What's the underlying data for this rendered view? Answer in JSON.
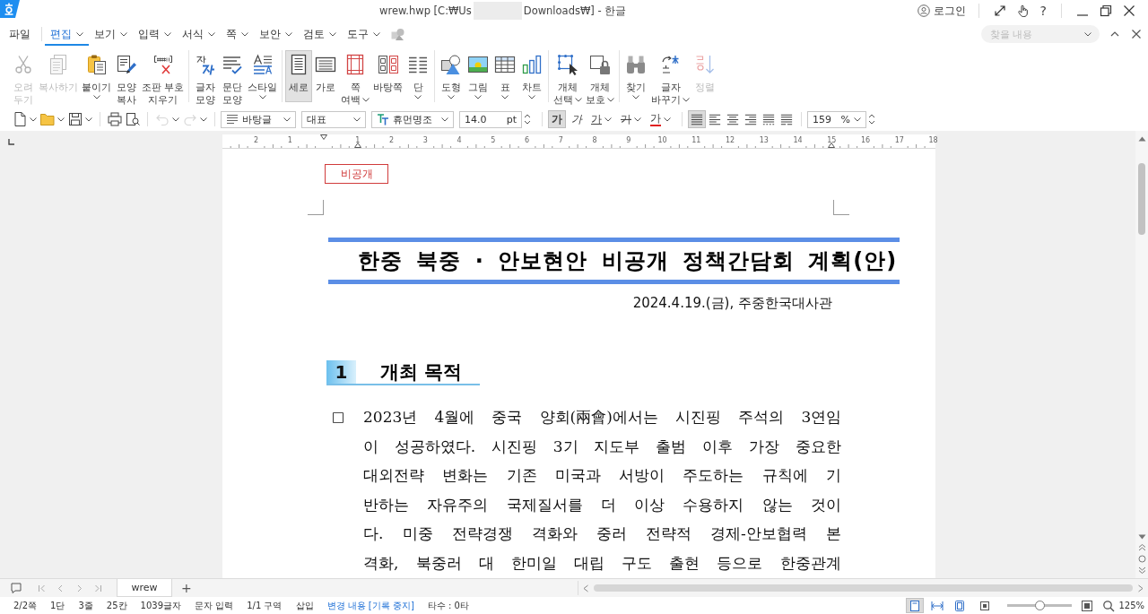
{
  "title_bar": {
    "title_parts": [
      "wrew.hwp [C:₩Us",
      "Downloads₩] - 한글"
    ],
    "login": "로그인",
    "help": "?"
  },
  "menu": {
    "items": [
      {
        "label": "파일",
        "kind": "plain",
        "selected": false
      },
      {
        "label": "편집",
        "kind": "dropdown",
        "selected": true
      },
      {
        "label": "보기",
        "kind": "dropdown",
        "selected": false
      },
      {
        "label": "입력",
        "kind": "dropdown",
        "selected": false
      },
      {
        "label": "서식",
        "kind": "dropdown",
        "selected": false
      },
      {
        "label": "쪽",
        "kind": "dropdown",
        "selected": false
      },
      {
        "label": "보안",
        "kind": "dropdown",
        "selected": false
      },
      {
        "label": "검토",
        "kind": "dropdown",
        "selected": false
      },
      {
        "label": "도구",
        "kind": "dropdown",
        "selected": false
      }
    ],
    "find": {
      "placeholder": "찾을 내용"
    }
  },
  "ribbon": {
    "groups": [
      {
        "items": [
          {
            "lines": [
              "오려",
              "두기"
            ],
            "dropdown": false,
            "disabled": true,
            "selected": false
          },
          {
            "lines": [
              "복사하기"
            ],
            "dropdown": false,
            "disabled": true,
            "selected": false
          },
          {
            "lines": [
              "붙이기"
            ],
            "dropdown": true,
            "disabled": false,
            "selected": false
          },
          {
            "lines": [
              "모양",
              "복사"
            ],
            "dropdown": false,
            "disabled": false,
            "selected": false
          },
          {
            "lines": [
              "조판 부호",
              "지우기"
            ],
            "dropdown": false,
            "disabled": false,
            "selected": false
          }
        ]
      },
      {
        "items": [
          {
            "lines": [
              "글자",
              "모양"
            ],
            "dropdown": false,
            "disabled": false,
            "selected": false
          },
          {
            "lines": [
              "문단",
              "모양"
            ],
            "dropdown": false,
            "disabled": false,
            "selected": false
          },
          {
            "lines": [
              "스타일"
            ],
            "dropdown": true,
            "disabled": false,
            "selected": false
          }
        ]
      },
      {
        "items": [
          {
            "lines": [
              "세로"
            ],
            "dropdown": false,
            "disabled": false,
            "selected": true
          },
          {
            "lines": [
              "가로"
            ],
            "dropdown": false,
            "disabled": false,
            "selected": false
          },
          {
            "lines": [
              "쪽",
              "여백"
            ],
            "dropdown": true,
            "disabled": false,
            "selected": false
          },
          {
            "lines": [
              "바탕쪽"
            ],
            "dropdown": false,
            "disabled": false,
            "selected": false
          },
          {
            "lines": [
              "단"
            ],
            "dropdown": true,
            "disabled": false,
            "selected": false
          }
        ]
      },
      {
        "items": [
          {
            "lines": [
              "도형"
            ],
            "dropdown": true,
            "disabled": false,
            "selected": false
          },
          {
            "lines": [
              "그림"
            ],
            "dropdown": true,
            "disabled": false,
            "selected": false
          },
          {
            "lines": [
              "표"
            ],
            "dropdown": true,
            "disabled": false,
            "selected": false
          },
          {
            "lines": [
              "차트"
            ],
            "dropdown": true,
            "disabled": false,
            "selected": false
          }
        ]
      },
      {
        "items": [
          {
            "lines": [
              "개체",
              "선택"
            ],
            "dropdown": true,
            "disabled": false,
            "selected": false
          },
          {
            "lines": [
              "개체",
              "보호"
            ],
            "dropdown": true,
            "disabled": false,
            "selected": false
          }
        ]
      },
      {
        "items": [
          {
            "lines": [
              "찾기"
            ],
            "dropdown": true,
            "disabled": false,
            "selected": false
          },
          {
            "lines": [
              "글자",
              "바꾸기"
            ],
            "dropdown": true,
            "disabled": false,
            "selected": false
          },
          {
            "lines": [
              "정렬"
            ],
            "dropdown": false,
            "disabled": true,
            "selected": false
          }
        ]
      }
    ]
  },
  "format_bar": {
    "file_buttons": [
      {
        "kind": "new",
        "dropdown": true,
        "disabled": false
      },
      {
        "kind": "open",
        "dropdown": true,
        "disabled": false
      },
      {
        "kind": "save",
        "dropdown": true,
        "disabled": false
      },
      {
        "kind": "print",
        "dropdown": false,
        "disabled": false
      },
      {
        "kind": "preview",
        "dropdown": false,
        "disabled": false
      },
      {
        "kind": "undo",
        "dropdown": true,
        "disabled": true
      },
      {
        "kind": "redo",
        "dropdown": true,
        "disabled": true
      }
    ],
    "style": "바탕글",
    "language": "대표",
    "font": "휴먼명조",
    "size": "14.0",
    "size_unit": "pt",
    "char_buttons": [
      {
        "label": "가",
        "kind": "bold",
        "dropdown": false,
        "selected": true
      },
      {
        "label": "가",
        "kind": "italic",
        "dropdown": false,
        "selected": false
      },
      {
        "label": "가",
        "kind": "underline",
        "dropdown": true,
        "selected": false
      },
      {
        "label": "가",
        "kind": "strikethrough",
        "dropdown": true,
        "selected": false
      },
      {
        "label": "가",
        "kind": "color",
        "dropdown": true,
        "selected": false
      }
    ],
    "align_buttons": [
      {
        "selected": true
      },
      {
        "selected": false
      },
      {
        "selected": false
      },
      {
        "selected": false
      },
      {
        "selected": false
      },
      {
        "selected": false
      }
    ],
    "zoom": "159",
    "zoom_unit": "%"
  },
  "ruler": {
    "left_labels": [
      "2",
      "1"
    ],
    "right_labels": [
      "1",
      "2",
      "3",
      "4",
      "5",
      "6",
      "7",
      "8",
      "9",
      "10",
      "11",
      "12",
      "13",
      "14",
      "15",
      "16",
      "17",
      "18"
    ]
  },
  "document": {
    "classification": "비공개",
    "title": "한중 북중 · 안보현안 비공개 정책간담회 계획(안)",
    "date_line": "2024.4.19.(금), 주중한국대사관",
    "sections": [
      {
        "number": "1",
        "heading": "개최 목적",
        "paragraphs": [
          {
            "bullet": "□",
            "lines": [
              "2023년 4월에 중국 양회(兩會)에서는 시진핑 주석의 3연임",
              "이 성공하였다. 시진핑 3기 지도부 출범 이후 가장 중요한",
              "대외전략 변화는 기존 미국과 서방이 주도하는 규칙에 기",
              "반하는 자유주의 국제질서를 더 이상 수용하지 않는 것이",
              "다. 미중 전략경쟁 격화와 중러 전략적 경제-안보협력 본",
              "격화, 북중러 대 한미일 대립 구도 출현 등으로 한중관계"
            ]
          }
        ]
      }
    ]
  },
  "sheet_tabs": {
    "tabs": [
      {
        "label": "wrew",
        "selected": true
      }
    ],
    "add": "+"
  },
  "status_bar": {
    "items": [
      {
        "text": "2/2쪽",
        "kind": "plain"
      },
      {
        "text": "1단",
        "kind": "plain"
      },
      {
        "text": "3줄",
        "kind": "plain"
      },
      {
        "text": "25칸",
        "kind": "plain"
      },
      {
        "text": "1039글자",
        "kind": "plain"
      },
      {
        "text": "문자 입력",
        "kind": "plain"
      },
      {
        "text": "1/1 구역",
        "kind": "plain"
      },
      {
        "text": "삽입",
        "kind": "plain"
      },
      {
        "text": "변경 내용 [기록 중지]",
        "kind": "link"
      },
      {
        "text": "타수 : 0타",
        "kind": "plain"
      }
    ],
    "views": [
      {
        "selected": true
      },
      {
        "selected": false
      },
      {
        "selected": false
      }
    ],
    "zoom_slider": {
      "level": 0.5
    },
    "zoom": "125%"
  }
}
